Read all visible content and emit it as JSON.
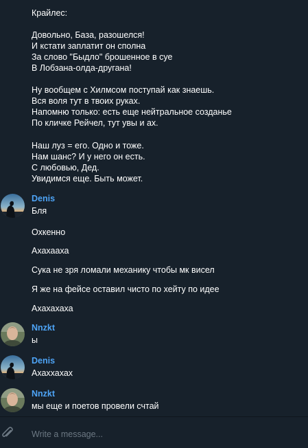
{
  "theme": {
    "background": "#17212b",
    "accent": "#4ea4f6",
    "placeholder_color": "#6c7883"
  },
  "messages": [
    {
      "lines": [
        "Крайлес:",
        "",
        "Довольно, База, разошелся!",
        "И кстати заплатит он сполна",
        "За слово \"Быдло\" брошенное в суе",
        "В Лобзана-олда-другана!",
        "",
        "Ну вообщем с Хилмсом поступай как знаешь.",
        "Вся воля тут в твоих руках.",
        "Напомню только: есть еще нейтральное созданье",
        "По кличке Рейчел, тут увы и ах.",
        "",
        "Наш луз = его. Одно и тоже.",
        "Нам шанс? И у него он есть.",
        "С любовью, Дед.",
        "Увидимся еще. Быть может."
      ]
    },
    {
      "sender": "Denis",
      "avatar": "sunset-silhouette-avatar",
      "lines": [
        "Бля",
        "Охкенно",
        "Ахахааха",
        "Сука не зря ломали механику чтобы мк висел",
        "Я же на фейсе оставил чисто по хейту по идее",
        "Ахахахаха"
      ]
    },
    {
      "sender": "Nnzkt",
      "avatar": "person-photo-avatar",
      "lines": [
        "ы"
      ]
    },
    {
      "sender": "Denis",
      "avatar": "sunset-silhouette-avatar",
      "lines": [
        "Ахаххахах"
      ]
    },
    {
      "sender": "Nnzkt",
      "avatar": "person-photo-avatar",
      "lines": [
        "мы еще и поетов провели счтай"
      ]
    }
  ],
  "composer": {
    "placeholder": "Write a message...",
    "attach_icon": "paperclip-icon"
  }
}
